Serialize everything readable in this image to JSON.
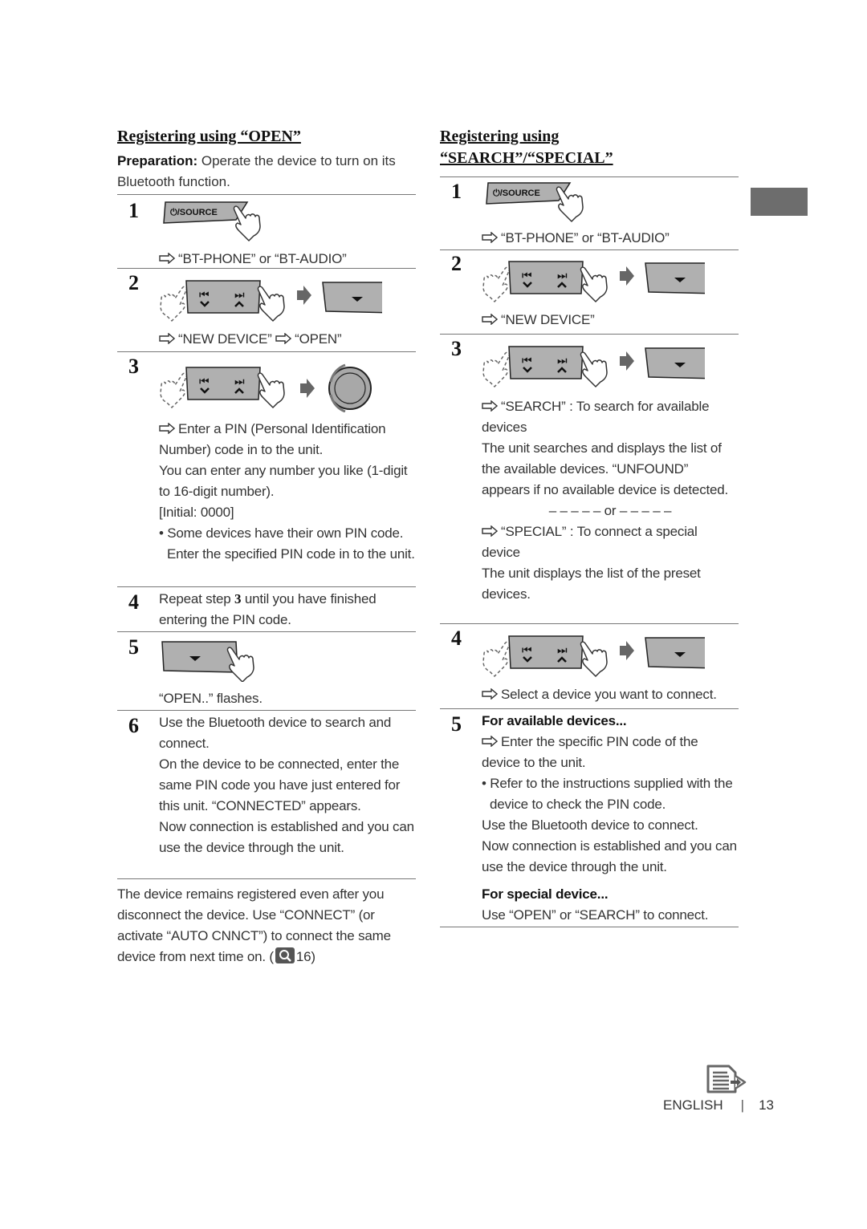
{
  "left": {
    "heading": "Registering using “OPEN”",
    "preparation_label": "Preparation:",
    "preparation_text": " Operate the device to turn on its Bluetooth function.",
    "steps": [
      {
        "num": "1",
        "button_label": "⏻/SOURCE",
        "result": "“BT-PHONE” or “BT-AUDIO”"
      },
      {
        "num": "2",
        "result_a": "“NEW DEVICE”",
        "result_b": "“OPEN”"
      },
      {
        "num": "3",
        "result": "Enter a PIN (Personal Identification Number) code in to the unit.",
        "line2": "You can enter any number you like (1-digit to 16-digit number).",
        "line3": "[Initial: 0000]",
        "bullet": "Some devices have their own PIN code. Enter the specified PIN code in to the unit."
      },
      {
        "num": "4",
        "text_a": "Repeat step ",
        "text_bold": "3",
        "text_b": " until you have finished entering the PIN code."
      },
      {
        "num": "5",
        "result": "“OPEN..” flashes."
      },
      {
        "num": "6",
        "text": "Use the Bluetooth device to search and connect.",
        "line2": "On the device to be connected, enter the same PIN code you have just entered for this unit. “CONNECTED” appears.",
        "line3": "Now connection is established and you can use the device through the unit."
      }
    ],
    "note": "The device remains registered even after you disconnect the device. Use “CONNECT” (or activate “AUTO CNNCT”) to connect the same device from next time on. (",
    "note_ref": "16)"
  },
  "right": {
    "heading_line1": "Registering using",
    "heading_line2": "“SEARCH”/“SPECIAL”",
    "steps": [
      {
        "num": "1",
        "button_label": "⏻/SOURCE",
        "result": "“BT-PHONE” or “BT-AUDIO”"
      },
      {
        "num": "2",
        "result": "“NEW DEVICE”"
      },
      {
        "num": "3",
        "result": "“SEARCH” : To search for available devices",
        "line2": "The unit searches and displays the list of the available devices. “UNFOUND” appears if no available device is detected.",
        "or": "– – – – – or – – – – –",
        "result2": "“SPECIAL” : To connect a special device",
        "line3": "The unit displays the list of the preset devices."
      },
      {
        "num": "4",
        "result": "Select a device you want to connect."
      },
      {
        "num": "5",
        "sub1": "For available devices...",
        "result": "Enter the specific PIN code of the device to the unit.",
        "bullet": "Refer to the instructions supplied with the device to check the PIN code.",
        "line2": "Use the Bluetooth device to connect.",
        "line3": "Now connection is established and you can use the device through the unit.",
        "sub2": "For special device...",
        "line4": "Use “OPEN” or “SEARCH” to connect."
      }
    ]
  },
  "footer": {
    "language": "ENGLISH",
    "page_number": "13"
  },
  "colors": {
    "text": "#333333",
    "rule": "#777777",
    "panel": "#b0b0b0",
    "side_tab": "#6d6d6d",
    "arrow": "#666666"
  }
}
